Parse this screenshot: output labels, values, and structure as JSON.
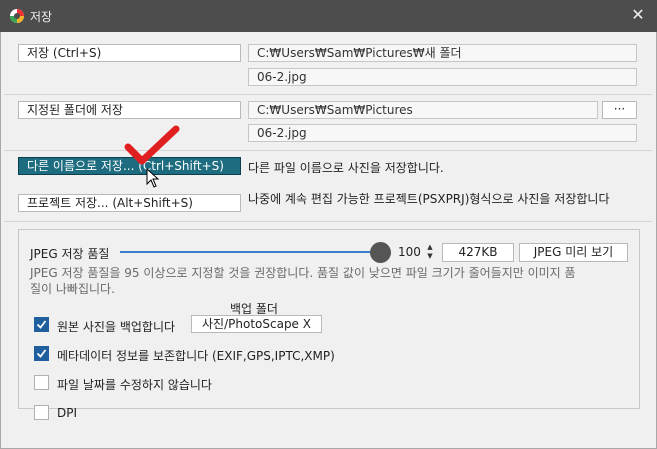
{
  "window": {
    "title": "저장",
    "close_glyph": "✕"
  },
  "save_rows": {
    "save": {
      "label": "저장   (Ctrl+S)",
      "path": "C:₩Users₩Sam₩Pictures₩새 폴더",
      "filename": "06-2.jpg"
    },
    "save_to_folder": {
      "label": "지정된 폴더에 저장",
      "path": "C:₩Users₩Sam₩Pictures",
      "browse_label": "···",
      "filename": "06-2.jpg"
    },
    "save_as": {
      "label": "다른 이름으로 저장...    (Ctrl+Shift+S)",
      "description": "다른 파일 이름으로 사진을 저장합니다."
    },
    "save_project": {
      "label": "프로젝트 저장...    (Alt+Shift+S)",
      "description": "나중에 계속 편집 가능한 프로젝트(PSXPRJ)형식으로 사진을 저장합니다"
    }
  },
  "jpeg": {
    "quality_label": "JPEG 저장 품질",
    "quality_value": "100",
    "quality_fraction": 1.0,
    "file_size": "427KB",
    "preview_button": "JPEG 미리 보기",
    "hint_line1": "JPEG 저장 품질을 95 이상으로 지정할 것을 권장합니다. 품질 값이 낮으면 파일 크기가 줄어들지만 이미지 품",
    "hint_line2": "질이 나빠집니다."
  },
  "backup": {
    "folder_heading": "백업 폴더",
    "folder_value": "사진/PhotoScape X"
  },
  "options": [
    {
      "label": "원본 사진을 백업합니다",
      "checked": true
    },
    {
      "label": "메타데이터 정보를 보존합니다 (EXIF,GPS,IPTC,XMP)",
      "checked": true
    },
    {
      "label": "파일 날짜를 수정하지 않습니다",
      "checked": false
    },
    {
      "label": "DPI",
      "checked": false
    }
  ],
  "colors": {
    "titlebar": "#4d4d4d",
    "primary_button": "#1d6c80",
    "checkbox_checked": "#1f5f9e",
    "annotation_check": "#e02020"
  },
  "icons": {
    "app": "photoscape-logo-icon",
    "close": "close-icon",
    "cursor": "mouse-pointer-icon",
    "annotation": "red-checkmark-icon"
  }
}
